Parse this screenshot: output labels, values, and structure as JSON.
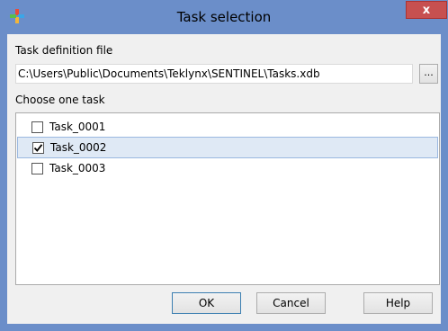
{
  "window": {
    "title": "Task selection",
    "close_label": "x",
    "app_icon": "plus-cross-icon"
  },
  "form": {
    "file_label": "Task definition file",
    "file_path": "C:\\Users\\Public\\Documents\\Teklynx\\SENTINEL\\Tasks.xdb",
    "browse_label": "...",
    "choose_label": "Choose one task"
  },
  "tasks": [
    {
      "label": "Task_0001",
      "checked": false,
      "selected": false
    },
    {
      "label": "Task_0002",
      "checked": true,
      "selected": true
    },
    {
      "label": "Task_0003",
      "checked": false,
      "selected": false
    }
  ],
  "buttons": {
    "ok": "OK",
    "cancel": "Cancel",
    "help": "Help"
  },
  "colors": {
    "title_bar": "#6b8ec9",
    "close_button": "#c75050",
    "selected_row": "#dfe9f5"
  }
}
